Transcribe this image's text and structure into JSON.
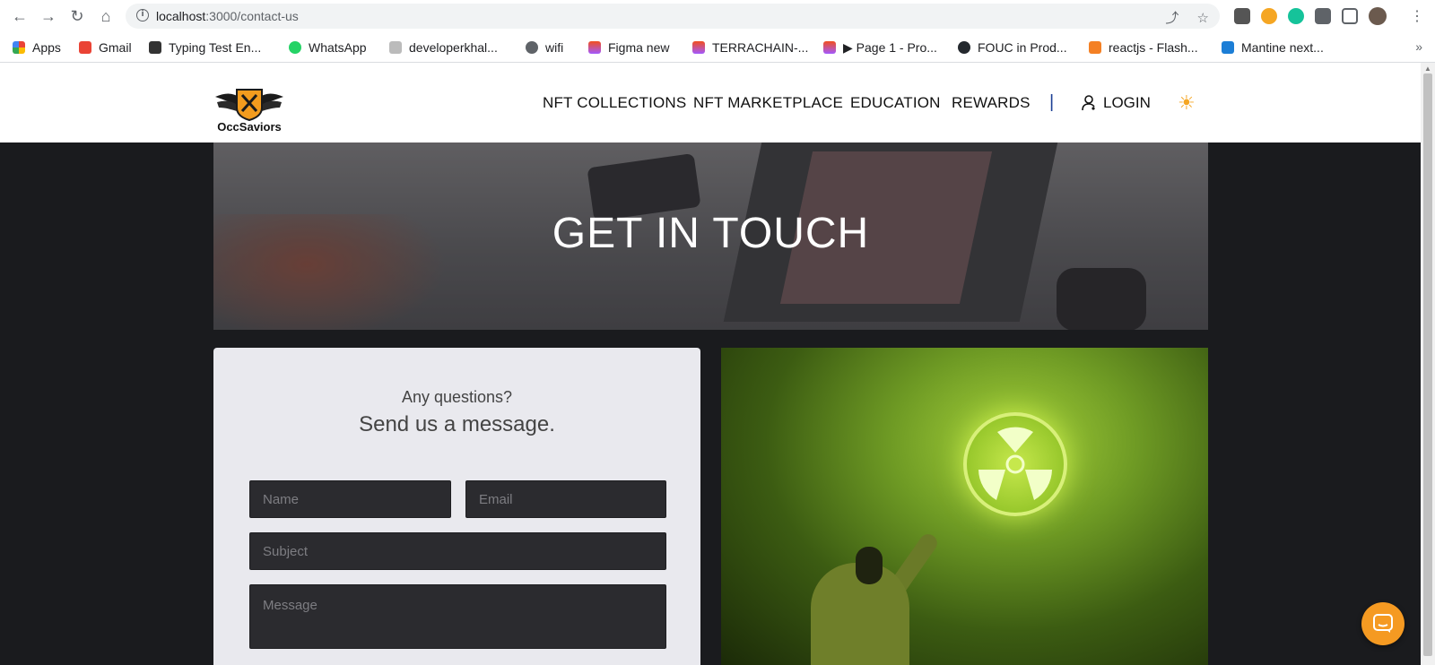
{
  "browser": {
    "url_host": "localhost",
    "url_path": ":3000/contact-us",
    "bookmarks": [
      {
        "label": "Apps",
        "color": "#ea4335"
      },
      {
        "label": "Gmail",
        "color": "#ea4335"
      },
      {
        "label": "Typing Test En...",
        "color": "#333333"
      },
      {
        "label": "WhatsApp",
        "color": "#25d366"
      },
      {
        "label": "developerkhal...",
        "color": "#777777"
      },
      {
        "label": "wifi",
        "color": "#5f6368"
      },
      {
        "label": "Figma new",
        "color": "#f24e1e"
      },
      {
        "label": "TERRACHAIN-...",
        "color": "#f24e1e"
      },
      {
        "label": "▶ Page 1 - Pro...",
        "color": "#a259ff"
      },
      {
        "label": "FOUC in Prod...",
        "color": "#24292e"
      },
      {
        "label": "reactjs - Flash...",
        "color": "#f48024"
      },
      {
        "label": "Mantine next...",
        "color": "#1c7ed6"
      }
    ],
    "more": "»"
  },
  "header": {
    "logo_text": "OccSaviors",
    "nav": [
      "NFT COLLECTIONS",
      "NFT MARKETPLACE",
      "EDUCATION",
      "REWARDS"
    ],
    "divider": "|",
    "login": "LOGIN",
    "accent_color": "#f5a623"
  },
  "hero": {
    "title": "GET IN TOUCH"
  },
  "contact": {
    "line1": "Any questions?",
    "line2": "Send us a message.",
    "name_placeholder": "Name",
    "email_placeholder": "Email",
    "subject_placeholder": "Subject",
    "message_placeholder": "Message"
  },
  "chat": {
    "icon": "chat-icon",
    "color": "#f59a22"
  }
}
